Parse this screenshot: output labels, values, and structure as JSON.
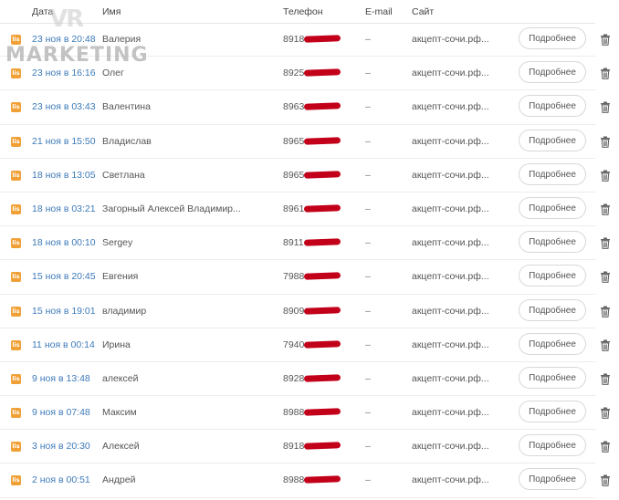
{
  "header": {
    "date": "Дата",
    "name": "Имя",
    "phone": "Телефон",
    "email": "E-mail",
    "site": "Сайт"
  },
  "watermark": {
    "top": "VR",
    "bottom": "MARKETING"
  },
  "source_icon_text": "lis",
  "rows": [
    {
      "date": "23 ноя в 20:48",
      "name": "Валерия",
      "phone": "8918",
      "email": "–",
      "site": "акцепт-сочи.рф...",
      "more": "Подробнее"
    },
    {
      "date": "23 ноя в 16:16",
      "name": "Олег",
      "phone": "8925",
      "email": "–",
      "site": "акцепт-сочи.рф...",
      "more": "Подробнее"
    },
    {
      "date": "23 ноя в 03:43",
      "name": "Валентина",
      "phone": "8963",
      "email": "–",
      "site": "акцепт-сочи.рф...",
      "more": "Подробнее"
    },
    {
      "date": "21 ноя в 15:50",
      "name": "Владислав",
      "phone": "8965",
      "email": "–",
      "site": "акцепт-сочи.рф...",
      "more": "Подробнее"
    },
    {
      "date": "18 ноя в 13:05",
      "name": "Светлана",
      "phone": "8965",
      "email": "–",
      "site": "акцепт-сочи.рф...",
      "more": "Подробнее"
    },
    {
      "date": "18 ноя в 03:21",
      "name": "Загорный Алексей Владимир...",
      "phone": "8961",
      "email": "–",
      "site": "акцепт-сочи.рф...",
      "more": "Подробнее"
    },
    {
      "date": "18 ноя в 00:10",
      "name": "Sergey",
      "phone": "8911",
      "email": "–",
      "site": "акцепт-сочи.рф...",
      "more": "Подробнее"
    },
    {
      "date": "15 ноя в 20:45",
      "name": "Евгения",
      "phone": "7988",
      "email": "–",
      "site": "акцепт-сочи.рф...",
      "more": "Подробнее"
    },
    {
      "date": "15 ноя в 19:01",
      "name": "владимир",
      "phone": "8909",
      "email": "–",
      "site": "акцепт-сочи.рф...",
      "more": "Подробнее"
    },
    {
      "date": "11 ноя в 00:14",
      "name": "Ирина",
      "phone": "7940",
      "email": "–",
      "site": "акцепт-сочи.рф...",
      "more": "Подробнее"
    },
    {
      "date": "9 ноя в 13:48",
      "name": "алексей",
      "phone": "8928",
      "email": "–",
      "site": "акцепт-сочи.рф...",
      "more": "Подробнее"
    },
    {
      "date": "9 ноя в 07:48",
      "name": "Максим",
      "phone": "8988",
      "email": "–",
      "site": "акцепт-сочи.рф...",
      "more": "Подробнее"
    },
    {
      "date": "3 ноя в 20:30",
      "name": "Алексей",
      "phone": "8918",
      "email": "–",
      "site": "акцепт-сочи.рф...",
      "more": "Подробнее"
    },
    {
      "date": "2 ноя в 00:51",
      "name": "Андрей",
      "phone": "8988",
      "email": "–",
      "site": "акцепт-сочи.рф...",
      "more": "Подробнее"
    }
  ],
  "colors": {
    "date_link": "#3d7ab8",
    "source_icon": "#f0a035",
    "redaction": "#c2001a"
  }
}
